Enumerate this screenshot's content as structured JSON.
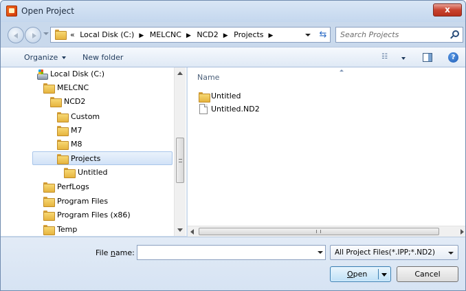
{
  "window": {
    "title": "Open Project",
    "close_label": "x"
  },
  "address_bar": {
    "overflow": "«",
    "crumbs": [
      "Local Disk (C:)",
      "MELCNC",
      "NCD2",
      "Projects"
    ],
    "separator": "▶"
  },
  "search": {
    "placeholder": "Search Projects"
  },
  "toolbar": {
    "organize_label": "Organize",
    "new_folder_label": "New folder",
    "views_glyph": "☷",
    "help_label": "?"
  },
  "nav_tree": {
    "items": [
      {
        "label": "Local Disk (C:)",
        "icon": "disk-icon"
      },
      {
        "label": "MELCNC",
        "icon": "folder-icon"
      },
      {
        "label": "NCD2",
        "icon": "folder-icon"
      },
      {
        "label": "Custom",
        "icon": "folder-icon"
      },
      {
        "label": "M7",
        "icon": "folder-icon"
      },
      {
        "label": "M8",
        "icon": "folder-icon"
      },
      {
        "label": "Projects",
        "icon": "folder-icon",
        "selected": true
      },
      {
        "label": "Untitled",
        "icon": "folder-icon"
      },
      {
        "label": "PerfLogs",
        "icon": "folder-icon"
      },
      {
        "label": "Program Files",
        "icon": "folder-icon"
      },
      {
        "label": "Program Files (x86)",
        "icon": "folder-icon"
      },
      {
        "label": "Temp",
        "icon": "folder-icon"
      }
    ]
  },
  "file_list": {
    "column_name": "Name",
    "items": [
      {
        "label": "Untitled",
        "icon": "folder-icon"
      },
      {
        "label": "Untitled.ND2",
        "icon": "file-icon"
      }
    ]
  },
  "footer": {
    "file_name_prefix": "File ",
    "file_name_accel": "n",
    "file_name_suffix": "ame:",
    "file_name_value": "",
    "filter_selected": "All Project Files(*.IPP;*.ND2)",
    "open_accel": "O",
    "open_rest": "pen",
    "cancel_label": "Cancel"
  },
  "colors": {
    "accent": "#3c7fb1",
    "selection": "#d1e2f7",
    "chrome": "#c9d9ec"
  }
}
